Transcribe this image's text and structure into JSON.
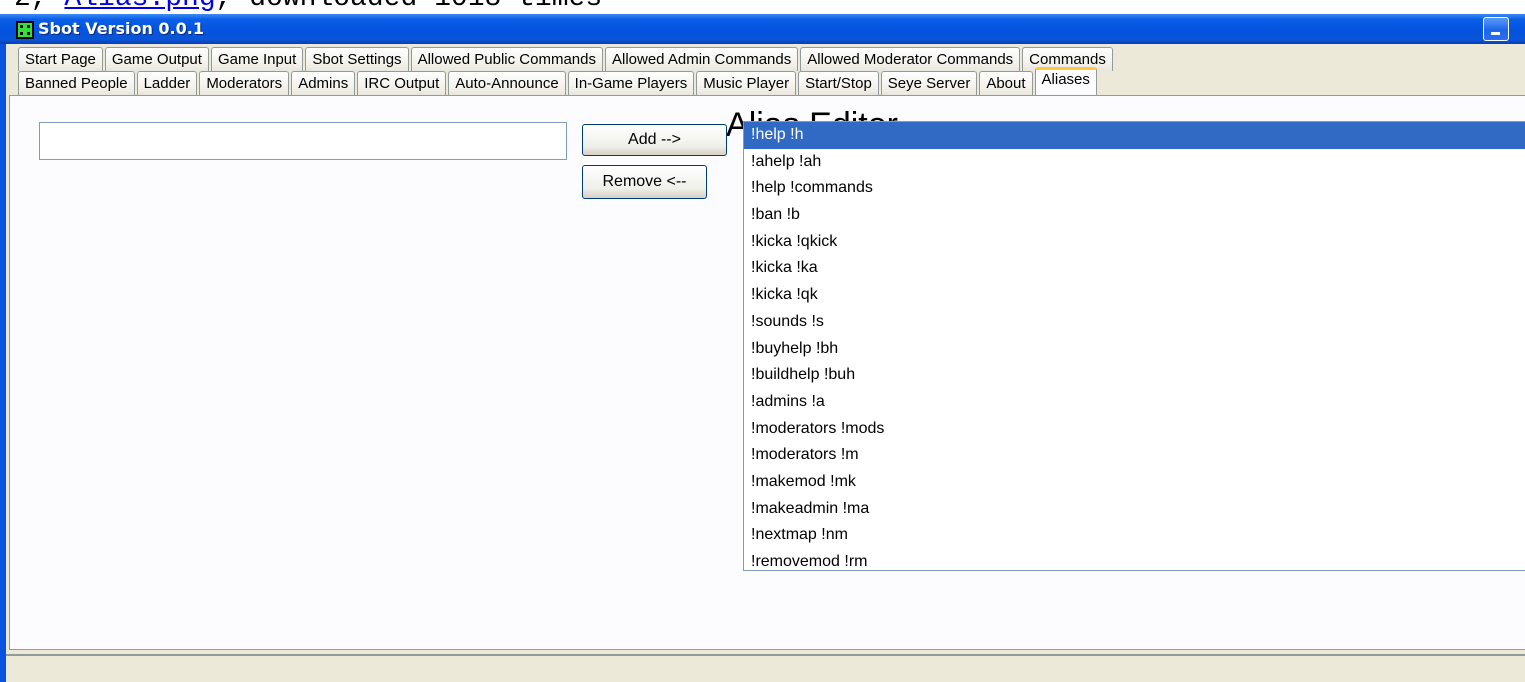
{
  "page_header": {
    "prefix": "2, ",
    "link": "Alias.png",
    "suffix": ", downloaded 1018 times"
  },
  "window": {
    "title": "Sbot Version 0.0.1",
    "icon": "sbot-app-icon"
  },
  "tabs": {
    "row1": [
      "Start Page",
      "Game Output",
      "Game Input",
      "Sbot Settings",
      "Allowed Public Commands",
      "Allowed Admin Commands",
      "Allowed Moderator Commands",
      "Commands"
    ],
    "row2": [
      "Banned People",
      "Ladder",
      "Moderators",
      "Admins",
      "IRC Output",
      "Auto-Announce",
      "In-Game Players",
      "Music Player",
      "Start/Stop",
      "Seye Server",
      "About",
      "Aliases"
    ],
    "active": "Aliases"
  },
  "alias_editor": {
    "title": "Alias Editor",
    "input_value": "",
    "add_label": "Add -->",
    "remove_label": "Remove <--",
    "selected_index": 0,
    "items": [
      "!help !h",
      "!ahelp !ah",
      "!help !commands",
      "!ban !b",
      "!kicka !qkick",
      "!kicka !ka",
      "!kicka !qk",
      "!sounds !s",
      "!buyhelp !bh",
      "!buildhelp !buh",
      "!admins !a",
      "!moderators !mods",
      "!moderators !m",
      "!makemod !mk",
      "!makeadmin !ma",
      "!nextmap !nm",
      "!removemod !rm"
    ]
  },
  "colors": {
    "selection": "#316ac5",
    "titlebar": "#0453df",
    "active_tab_accent": "#ffc83c"
  }
}
